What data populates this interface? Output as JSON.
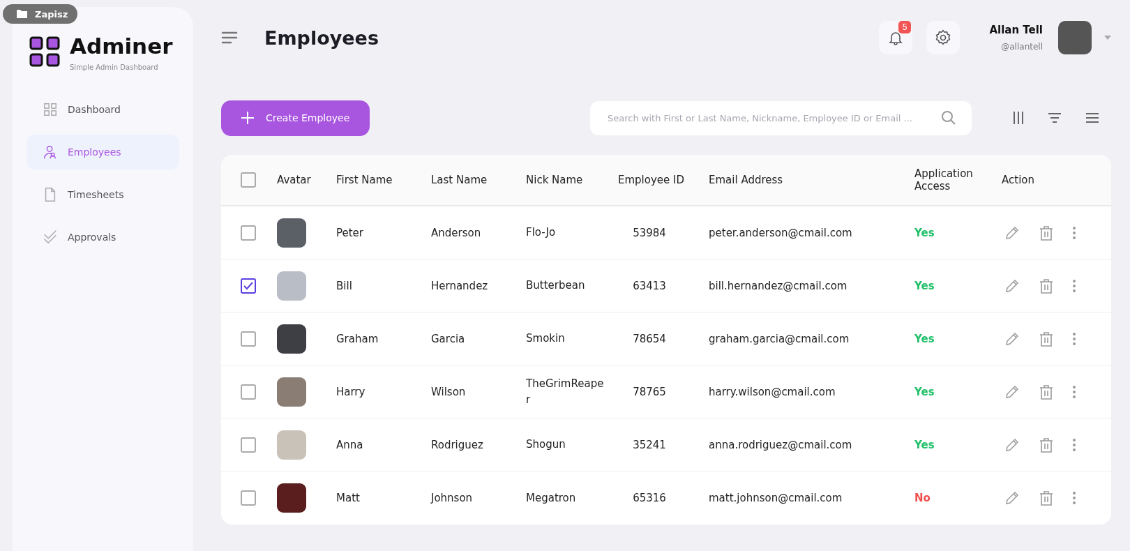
{
  "overlay_button": {
    "label": "Zapisz"
  },
  "brand": {
    "name": "Adminer",
    "tagline": "Simple Admin Dashboard"
  },
  "sidebar": {
    "items": [
      {
        "label": "Dashboard",
        "selected": false
      },
      {
        "label": "Employees",
        "selected": true
      },
      {
        "label": "Timesheets",
        "selected": false
      },
      {
        "label": "Approvals",
        "selected": false
      }
    ]
  },
  "header": {
    "title": "Employees",
    "notifications": "5",
    "user": {
      "name": "Allan Tell",
      "handle": "@allantell"
    }
  },
  "toolbar": {
    "create_button": "Create Employee",
    "search": {
      "placeholder": "Search with First or Last Name, Nickname, Employee ID or Email ..."
    }
  },
  "table": {
    "header_checked": false,
    "columns": [
      "Avatar",
      "First Name",
      "Last Name",
      "Nick Name",
      "Employee ID",
      "Email Address",
      "Application Access",
      "Action"
    ],
    "rows": [
      {
        "selected": false,
        "first": "Peter",
        "last": "Anderson",
        "nick": "Flo-Jo",
        "id": "53984",
        "email": "peter.anderson@cmail.com",
        "access": "Yes",
        "granted": true
      },
      {
        "selected": true,
        "first": "Bill",
        "last": "Hernandez",
        "nick": "Butterbean",
        "id": "63413",
        "email": "bill.hernandez@cmail.com",
        "access": "Yes",
        "granted": true
      },
      {
        "selected": false,
        "first": "Graham",
        "last": "Garcia",
        "nick": "Smokin",
        "id": "78654",
        "email": "graham.garcia@cmail.com",
        "access": "Yes",
        "granted": true
      },
      {
        "selected": false,
        "first": "Harry",
        "last": "Wilson",
        "nick": "TheGrimReaper",
        "id": "78765",
        "email": "harry.wilson@cmail.com",
        "access": "Yes",
        "granted": true
      },
      {
        "selected": false,
        "first": "Anna",
        "last": "Rodriguez",
        "nick": "Shogun",
        "id": "35241",
        "email": "anna.rodriguez@cmail.com",
        "access": "Yes",
        "granted": true
      },
      {
        "selected": false,
        "first": "Matt",
        "last": "Johnson",
        "nick": "Megatron",
        "id": "65316",
        "email": "matt.johnson@cmail.com",
        "access": "No",
        "granted": false
      }
    ]
  }
}
